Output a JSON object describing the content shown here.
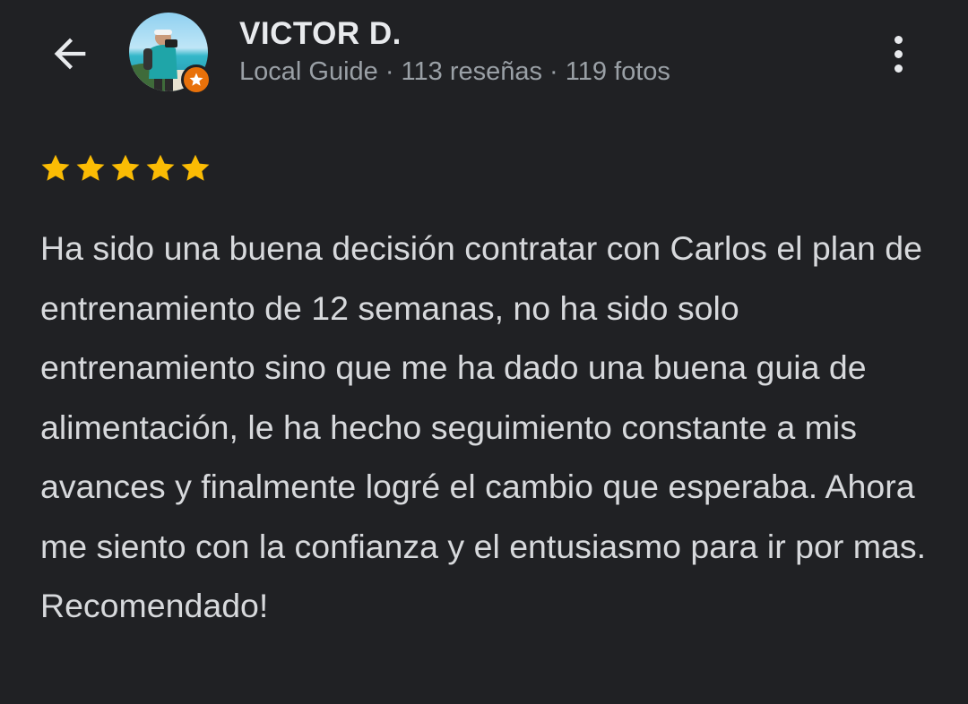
{
  "header": {
    "back_icon": "arrow-back-icon",
    "more_icon": "more-vert-icon"
  },
  "reviewer": {
    "name": "VICTOR D.",
    "meta": "Local Guide · 113 reseñas · 119 fotos",
    "avatar_icon": "user-photo",
    "badge_icon": "local-guide-star-icon",
    "badge_color": "#e8710a"
  },
  "review": {
    "rating": 5,
    "rating_max": 5,
    "star_color": "#fbbc04",
    "text": "Ha sido una buena decisión contratar con Carlos el plan de entrenamiento de 12 semanas, no ha sido solo entrenamiento sino que me ha dado una buena guia de alimentación, le ha hecho seguimiento constante a mis avances y finalmente logré el cambio que esperaba. Ahora me siento con la confianza y el entusiasmo para ir por mas. Recomendado!"
  },
  "colors": {
    "background": "#202124",
    "primary_text": "#e8eaed",
    "secondary_text": "#9aa0a6"
  }
}
